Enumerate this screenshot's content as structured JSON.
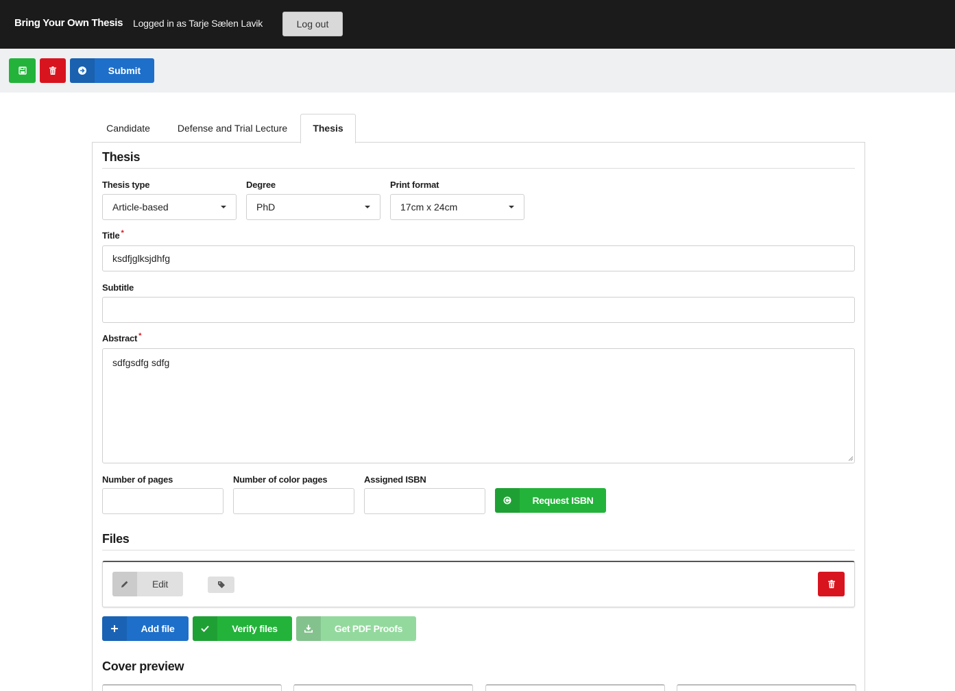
{
  "header": {
    "brand": "Bring Your Own Thesis",
    "logged_in_text": "Logged in as Tarje Sælen Lavik",
    "logout_label": "Log out"
  },
  "toolbar": {
    "save_icon": "floppy-disk-icon",
    "delete_icon": "trash-icon",
    "submit_icon": "arrow-circle-right-icon",
    "submit_label": "Submit"
  },
  "tabs": [
    {
      "label": "Candidate",
      "active": false
    },
    {
      "label": "Defense and Trial Lecture",
      "active": false
    },
    {
      "label": "Thesis",
      "active": true
    }
  ],
  "thesis": {
    "section_title": "Thesis",
    "thesis_type": {
      "label": "Thesis type",
      "value": "Article-based"
    },
    "degree": {
      "label": "Degree",
      "value": "PhD"
    },
    "print_format": {
      "label": "Print format",
      "value": "17cm x 24cm"
    },
    "title": {
      "label": "Title",
      "required_mark": "*",
      "value": "ksdfjglksjdhfg"
    },
    "subtitle": {
      "label": "Subtitle",
      "value": ""
    },
    "abstract": {
      "label": "Abstract",
      "required_mark": "*",
      "value": "sdfgsdfg sdfg"
    },
    "num_pages": {
      "label": "Number of pages",
      "value": ""
    },
    "num_color_pages": {
      "label": "Number of color pages",
      "value": ""
    },
    "assigned_isbn": {
      "label": "Assigned ISBN",
      "value": ""
    },
    "request_isbn_label": "Request ISBN"
  },
  "files": {
    "section_title": "Files",
    "edit_label": "Edit",
    "add_file_label": "Add file",
    "verify_files_label": "Verify files",
    "get_pdf_proofs_label": "Get PDF Proofs"
  },
  "cover": {
    "section_title": "Cover preview"
  },
  "colors": {
    "header_bg": "#1b1b1b",
    "toolbar_bg": "#eff0f2",
    "green": "#23b33a",
    "red": "#d8151f",
    "blue": "#1e6fc9",
    "green_disabled": "#93d99d"
  }
}
